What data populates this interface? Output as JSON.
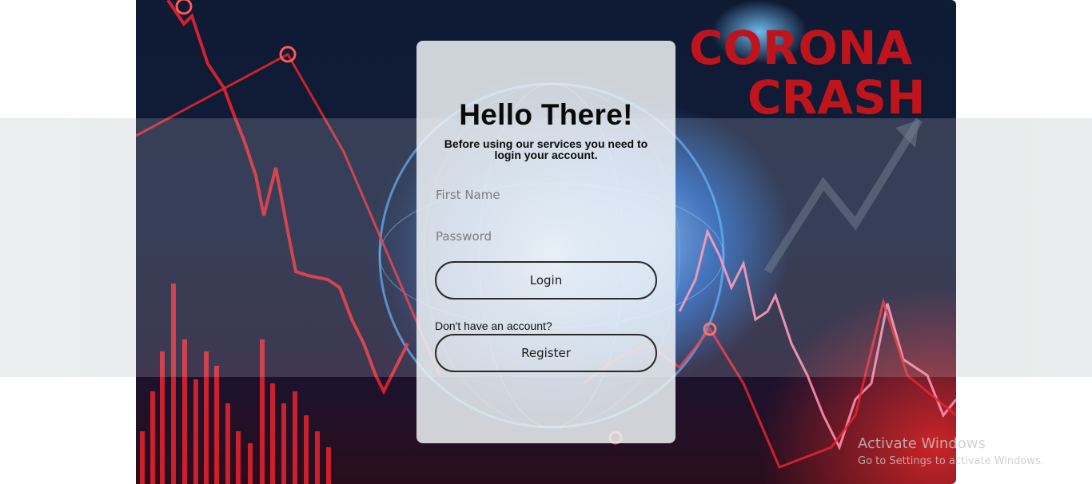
{
  "background": {
    "logo_line1": "CORONA",
    "logo_line2": "CRASH",
    "colors": {
      "deep_navy": "#0f1a33",
      "globe_blue": "#2878e6",
      "chart_red": "#e8242f"
    }
  },
  "login_card": {
    "title": "Hello There!",
    "subtitle": "Before using our services you need to login your account.",
    "first_name_placeholder": "First Name",
    "password_placeholder": "Password",
    "login_label": "Login",
    "no_account_text": "Don't have an account?",
    "register_label": "Register"
  },
  "watermark": {
    "line1": "Activate Windows",
    "line2": "Go to Settings to activate Windows."
  }
}
